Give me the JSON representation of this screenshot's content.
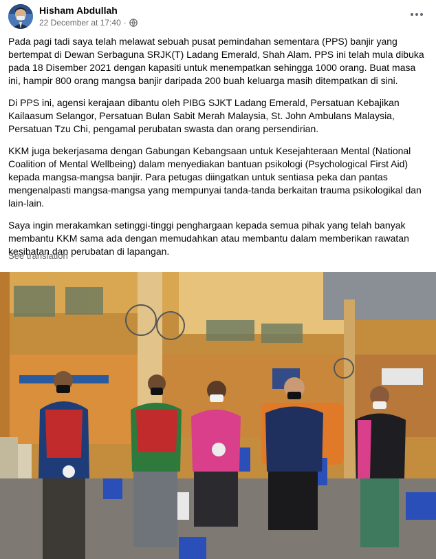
{
  "post": {
    "author": "Hisham Abdullah",
    "timestamp": "22 December at 17:40",
    "separator": "·",
    "paragraphs": [
      "Pada pagi tadi saya telah melawat sebuah pusat pemindahan sementara (PPS) banjir yang bertempat di Dewan Serbaguna SRJK(T) Ladang Emerald, Shah Alam. PPS ini telah mula dibuka pada 18 Disember 2021 dengan kapasiti untuk menempatkan sehingga 1000 orang. Buat masa ini, hampir 800 orang mangsa banjir daripada 200 buah keluarga masih ditempatkan di sini.",
      "Di PPS ini, agensi kerajaan dibantu oleh PIBG SJKT Ladang Emerald, Persatuan Kebajikan Kailaasum Selangor, Persatuan Bulan Sabit Merah Malaysia, St. John Ambulans Malaysia, Persatuan Tzu Chi, pengamal perubatan swasta dan orang persendirian.",
      "KKM juga bekerjasama dengan Gabungan Kebangsaan untuk Kesejahteraan Mental (National Coalition of Mental Wellbeing) dalam menyediakan bantuan psikologi (Psychological First Aid) kepada mangsa-mangsa banjir. Para petugas diingatkan untuk sentiasa peka dan pantas mengenalpasti mangsa-mangsa yang mempunyai tanda-tanda berkaitan trauma psikologikal dan lain-lain.",
      "Saya ingin merakamkan setinggi-tinggi penghargaan kepada semua pihak yang telah banyak membantu KKM sama ada dengan memudahkan atau membantu dalam memberikan rawatan kesihatan dan perubatan di lapangan."
    ],
    "see_translation": "See translation",
    "icons": {
      "avatar": "profile-photo",
      "privacy": "globe-icon",
      "more": "more-options-icon"
    }
  },
  "colors": {
    "text": "#050505",
    "secondary_text": "#65676b",
    "background": "#ffffff"
  }
}
